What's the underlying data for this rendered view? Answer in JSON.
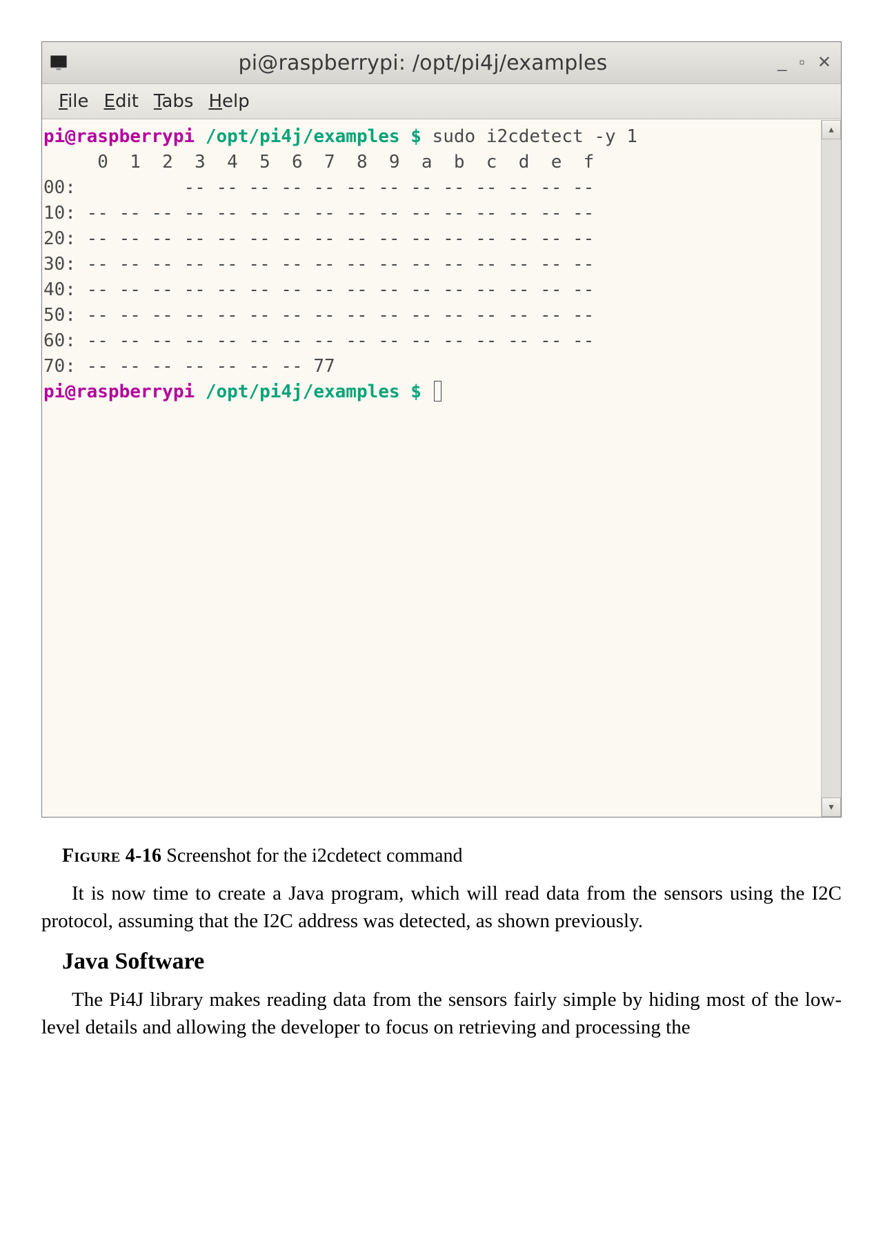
{
  "window": {
    "title": "pi@raspberrypi: /opt/pi4j/examples",
    "menus": {
      "file": "File",
      "edit": "Edit",
      "tabs": "Tabs",
      "help": "Help"
    },
    "win_btns": {
      "min": "_",
      "max": "▫",
      "close": "✕"
    }
  },
  "prompt": {
    "user": "pi@raspberrypi",
    "path": "/opt/pi4j/examples",
    "dollar": "$"
  },
  "command": "sudo i2cdetect -y 1",
  "i2c_output": {
    "header": "     0  1  2  3  4  5  6  7  8  9  a  b  c  d  e  f",
    "rows": [
      "00:          -- -- -- -- -- -- -- -- -- -- -- -- --",
      "10: -- -- -- -- -- -- -- -- -- -- -- -- -- -- -- --",
      "20: -- -- -- -- -- -- -- -- -- -- -- -- -- -- -- --",
      "30: -- -- -- -- -- -- -- -- -- -- -- -- -- -- -- --",
      "40: -- -- -- -- -- -- -- -- -- -- -- -- -- -- -- --",
      "50: -- -- -- -- -- -- -- -- -- -- -- -- -- -- -- --",
      "60: -- -- -- -- -- -- -- -- -- -- -- -- -- -- -- --",
      "70: -- -- -- -- -- -- -- 77"
    ]
  },
  "caption": {
    "label": "Figure 4-16",
    "text": " Screenshot for the i2cdetect command"
  },
  "para1": "It is now time to create a Java program, which will read data from the sensors using the I2C protocol, assuming that the I2C address was detected, as shown previously.",
  "section": "Java Software",
  "para2": "The Pi4J library makes reading data from the sensors fairly simple by hiding most of the low-level details and allowing the developer to focus on retrieving and processing the"
}
